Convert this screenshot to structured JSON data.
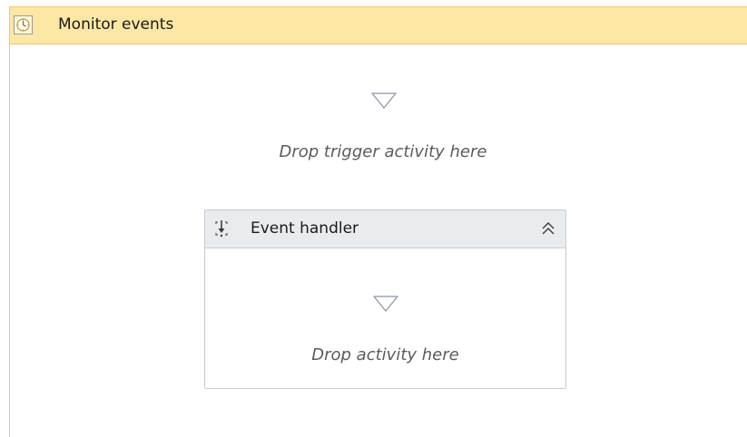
{
  "monitor": {
    "title": "Monitor events",
    "drop_trigger_text": "Drop trigger activity here"
  },
  "event_handler": {
    "title": "Event handler",
    "drop_activity_text": "Drop activity here"
  },
  "colors": {
    "outer_header_bg": "#fde7a4",
    "outer_border": "#f2c96b",
    "inner_header_bg": "#e9ecef",
    "arrow_stroke": "#8a97a8"
  },
  "icons": {
    "monitor": "clock-icon",
    "handler": "event-handler-icon",
    "collapse": "double-chevron-up-icon",
    "drop": "drop-arrow-icon"
  }
}
